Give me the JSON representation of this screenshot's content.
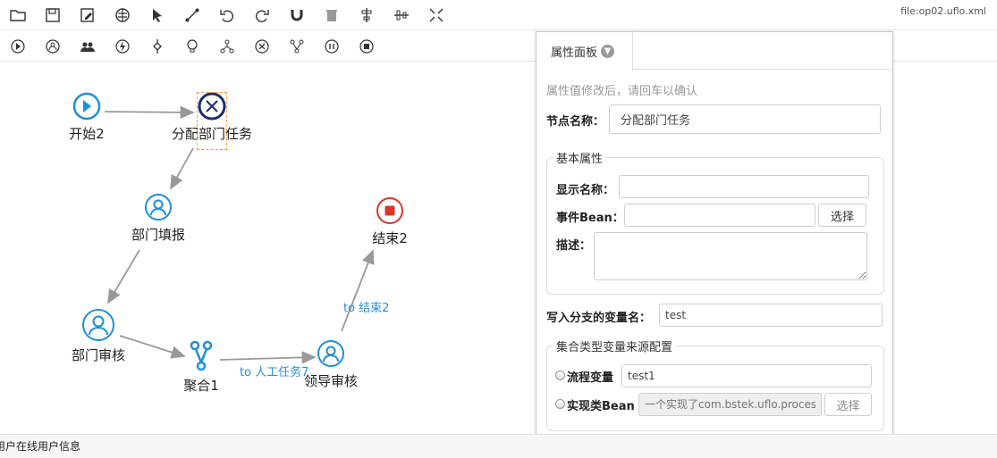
{
  "file_label": "file:op02.uflo.xml",
  "toolbar_top": [
    "open-folder-icon",
    "save-icon",
    "save-as-icon",
    "deploy-icon",
    "select-pointer-icon",
    "connection-icon",
    "undo-icon",
    "redo-icon",
    "magnet-icon",
    "delete-icon",
    "align-center-icon",
    "align-middle-icon",
    "shrink-icon"
  ],
  "toolbar_bottom": [
    "start-node-icon",
    "human-task-icon",
    "fork-join-users-icon",
    "action-icon",
    "decision-icon",
    "idea-icon",
    "fork-icon",
    "cancel-icon",
    "join-icon",
    "sub-process-icon",
    "end-node-icon"
  ],
  "nodes": {
    "start": {
      "label": "开始2"
    },
    "assign": {
      "label": "分配部门任务"
    },
    "fill": {
      "label": "部门填报"
    },
    "audit": {
      "label": "部门审核"
    },
    "join": {
      "label": "聚合1"
    },
    "leader": {
      "label": "领导审核"
    },
    "end": {
      "label": "结束2"
    }
  },
  "edges": {
    "to_end": "to 结束2",
    "to_task": "to 人工任务7"
  },
  "panel": {
    "tab_label": "属性面板",
    "hint": "属性值修改后，请回车以确认",
    "node_name_label": "节点名称：",
    "node_name_value": "分配部门任务",
    "basic_legend": "基本属性",
    "display_name_label": "显示名称：",
    "display_name_value": "",
    "event_bean_label": "事件Bean：",
    "event_bean_value": "",
    "select_label": "选择",
    "desc_label": "描述：",
    "desc_value": "",
    "var_label": "写入分支的变量名：",
    "var_value": "test",
    "collection_legend": "集合类型变量来源配置",
    "process_var_label": "流程变量",
    "process_var_value": "test1",
    "impl_bean_label": "实现类Bean",
    "impl_bean_placeholder": "一个实现了com.bstek.uflo.process.ha",
    "select_label_2": "选择"
  },
  "status_text": "用户在线用户信息",
  "colors": {
    "accent": "#2b8fd6",
    "end": "#d9372a",
    "node_blue": "#1e90d6",
    "dark_blue": "#1a2f6e"
  }
}
